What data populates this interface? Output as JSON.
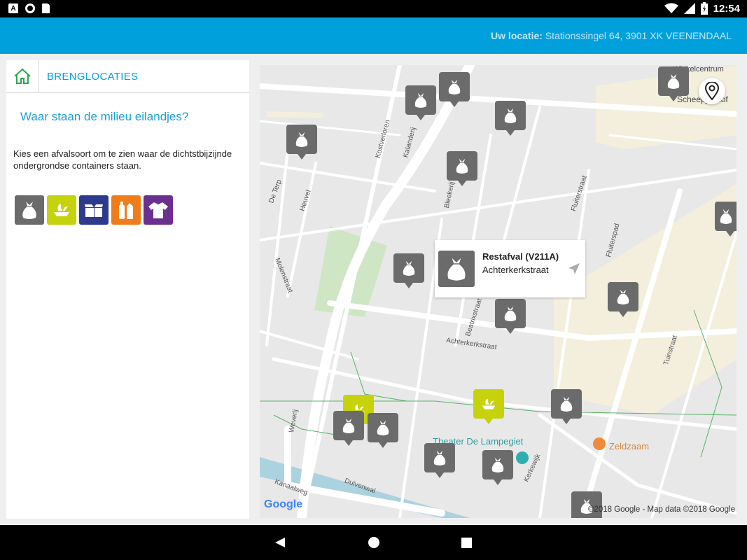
{
  "status_bar": {
    "left_icons": [
      "a-notification-icon",
      "circle-notification-icon",
      "sd-card-icon"
    ],
    "right_icons": [
      "wifi-icon",
      "signal-icon",
      "battery-icon"
    ],
    "time": "12:54"
  },
  "app_bar": {
    "location_label": "Uw locatie:",
    "location_value": " Stationssingel 64, 3901 XK VEENENDAAL"
  },
  "panel": {
    "breadcrumb_icon": "home-icon",
    "breadcrumb": "BRENGLOCATIES",
    "title": "Waar staan de milieu eilandjes?",
    "description": "Kies een afvalsoort om te zien waar de dichtstbijzijnde ondergrondse containers staan.",
    "waste_types": [
      {
        "icon": "restafval-bag-icon",
        "color": "#6b6b6b"
      },
      {
        "icon": "gft-icon",
        "color": "#c5d20c"
      },
      {
        "icon": "papier-karton-icon",
        "color": "#2e3a8c"
      },
      {
        "icon": "plastic-drankkarton-icon",
        "color": "#f07d1a"
      },
      {
        "icon": "textiel-shirt-icon",
        "color": "#6a2f8f"
      }
    ]
  },
  "map": {
    "streets": [
      "Kostverloren",
      "Kalanderij",
      "De Terp",
      "Heuvel",
      "Bleekerij",
      "Fluiterstraat",
      "Fluiterspad",
      "Molenstraat",
      "Beatrixstraat",
      "Achterkerkstraat",
      "Tuinstraat",
      "Weverij",
      "Duivenwal",
      "Kanaalweg",
      "Kerkewijk"
    ],
    "pois": {
      "theater": "Theater De Lampegiet",
      "shop": "Zeldzaam",
      "centrum": "Winkelcentrum",
      "centrum2": "Scheepjeshof"
    },
    "popup": {
      "title": "Restafval (V211A)",
      "subtitle": "Achterkerkstraat"
    },
    "google_logo": "Google",
    "attribution": "©2018 Google - Map data ©2018 Google"
  },
  "nav_bar": {
    "buttons": [
      "back-icon",
      "home-circle-icon",
      "recents-square-icon"
    ]
  },
  "colors": {
    "accent": "#00a0dc",
    "restafval": "#6b6b6b",
    "gft": "#c5d20c"
  }
}
